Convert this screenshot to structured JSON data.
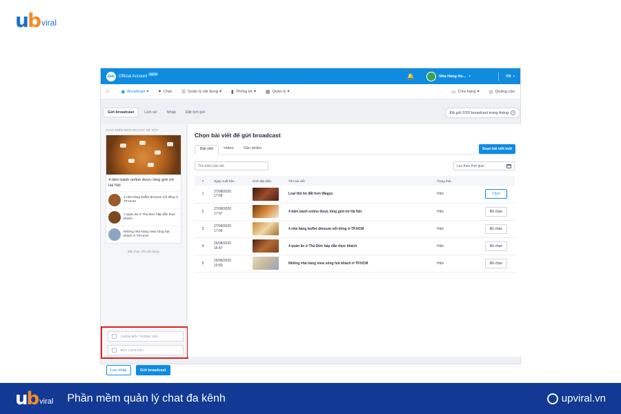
{
  "brand": {
    "logo_mark": "ub",
    "logo_text": "viral"
  },
  "app": {
    "topbar": {
      "logo": "Zalo",
      "title": "Official Account",
      "beta": "BETA",
      "page_name": "Nhà Hàng Ho...",
      "lang": "VN"
    },
    "nav": {
      "items": [
        {
          "icon": "home-icon",
          "label": ""
        },
        {
          "icon": "broadcast-icon",
          "label": "Broadcast",
          "active": true
        },
        {
          "icon": "chat-icon",
          "label": "Chat"
        },
        {
          "icon": "list-icon",
          "label": "Quản lý nội dung"
        },
        {
          "icon": "stats-icon",
          "label": "Thống kê"
        },
        {
          "icon": "grid-icon",
          "label": "Quản lý"
        }
      ],
      "right": [
        {
          "icon": "store-icon",
          "label": "Cửa hàng"
        },
        {
          "icon": "ads-icon",
          "label": "Quảng cáo"
        }
      ]
    },
    "subtabs": [
      "Gửi broadcast",
      "Lịch sử",
      "Nháp",
      "Đặt lịch gửi"
    ],
    "quota": "Đã gửi 2/20 broadcast trong tháng",
    "left": {
      "heading": "GIAO DIỆN BROADCAST SẼ GỬI",
      "hero_title": "4 tiệm bánh online được lòng giới trẻ Hà Nội",
      "items": [
        {
          "text": "4 nhà hàng buffet dimsum nổi tiếng ở TP.HCM",
          "color": "#9a5a2a"
        },
        {
          "text": "4 quán ăn ở Thủ Đức hấp dẫn thực khách",
          "color": "#7a4a20"
        },
        {
          "text": "Những nhà hàng view sông hút khách ở TP.HCM",
          "color": "#8fa6c2"
        }
      ],
      "count": "Đã chọn 4/5 nội dung",
      "option_target": "CHỌN ĐỐI TƯỢNG GỬI",
      "option_schedule": "ĐẶT LỊCH GỬI",
      "save_draft": "Lưu nháp",
      "send": "Gửi broadcast"
    },
    "panel": {
      "title": "Chọn bài viết để gửi broadcast",
      "tabs": [
        "Bài viết",
        "Video",
        "Sản phẩm"
      ],
      "new_button": "Soạn bài viết mới",
      "search_placeholder": "Tìm kiếm bài viết",
      "date_filter": "Lọc theo thời gian",
      "columns": [
        "#",
        "Ngày xuất bản",
        "Hình đại diện",
        "Tên bài viết",
        "Trạng thái",
        ""
      ],
      "rows": [
        {
          "no": "1",
          "date": "27/08/2020",
          "time": "17:08",
          "title": "Loại thịt bò đắt hơn Wagyu",
          "status": "Hiện",
          "action": "Chọn",
          "thumb": "#6b2f1c",
          "chosen": false
        },
        {
          "no": "2",
          "date": "27/08/2020",
          "time": "17:07",
          "title": "4 tiệm bánh online được lòng giới trẻ Hà Nội",
          "status": "Hiện",
          "action": "Bỏ chọn",
          "thumb": "#b4662a",
          "chosen": true
        },
        {
          "no": "3",
          "date": "27/08/2020",
          "time": "17:05",
          "title": "4 nhà hàng buffet dimsum nổi tiếng ở TP.HCM",
          "status": "Hiện",
          "action": "Bỏ chọn",
          "thumb": "#a9712e",
          "chosen": true
        },
        {
          "no": "4",
          "date": "25/08/2020",
          "time": "15:47",
          "title": "4 quán ăn ở Thủ Đức hấp dẫn thực khách",
          "status": "Hiện",
          "action": "Bỏ chọn",
          "thumb": "#7a4320",
          "chosen": true
        },
        {
          "no": "5",
          "date": "25/06/2020",
          "time": "10:59",
          "title": "Những nhà hàng view sông hút khách ở TP.HCM",
          "status": "Hiện",
          "action": "Bỏ chọn",
          "thumb": "#c9b89a",
          "chosen": true
        }
      ]
    }
  },
  "footer": {
    "slogan": "Phần mềm quản lý chat đa kênh",
    "site": "upviral.vn"
  },
  "colors": {
    "accent": "#0f8ce0",
    "footer": "#123a94",
    "highlight": "#e02020",
    "logo_orange": "#f28c28"
  }
}
